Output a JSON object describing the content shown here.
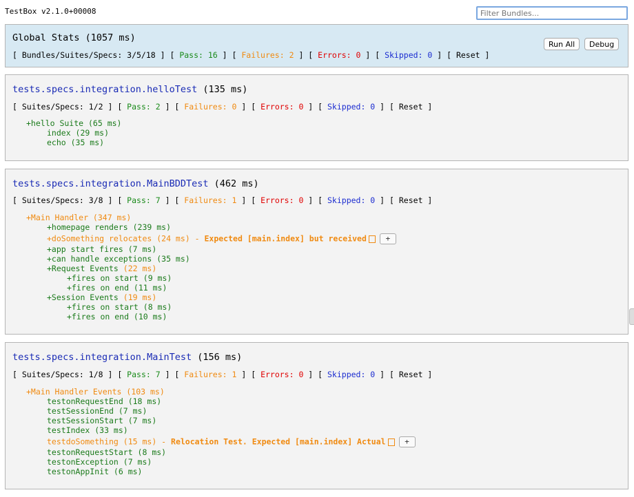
{
  "header": {
    "version": "TestBox v2.1.0+00008",
    "filter_placeholder": "Filter Bundles..."
  },
  "global": {
    "title": "Global Stats (1057 ms)",
    "stats": {
      "prefix": "[ Bundles/Suites/Specs: 3/5/18 ] [ ",
      "pass": "Pass: 16",
      "fail": "Failures: 2",
      "err": "Errors: 0",
      "skip": "Skipped: 0",
      "reset": "Reset"
    },
    "run_all": "Run All",
    "debug": "Debug"
  },
  "bundles": [
    {
      "name": "tests.specs.integration.helloTest",
      "time": " (135 ms)",
      "stats": {
        "prefix": "[ Suites/Specs: 1/2 ] [ ",
        "pass": "Pass: 2",
        "fail": "Failures: 0",
        "err": "Errors: 0",
        "skip": "Skipped: 0",
        "reset": "Reset"
      },
      "lines": [
        "+hello Suite (65 ms)",
        "index (29 ms)",
        "echo (35 ms)"
      ]
    },
    {
      "name": "tests.specs.integration.MainBDDTest",
      "time": " (462 ms)",
      "stats": {
        "prefix": "[ Suites/Specs: 3/8 ] [ ",
        "pass": "Pass: 7",
        "fail": "Failures: 1",
        "err": "Errors: 0",
        "skip": "Skipped: 0",
        "reset": "Reset"
      },
      "lines": [
        "+Main Handler (347 ms)",
        "+homepage renders (239 ms)",
        "+doSomething relocates (24 ms) - ",
        "Expected [main.index] but received",
        "+app start fires (7 ms)",
        "+can handle exceptions (35 ms)",
        "+Request Events",
        " (22 ms)",
        "+fires on start (9 ms)",
        "+fires on end (11 ms)",
        "+Session Events",
        " (19 ms)",
        "+fires on start (8 ms)",
        "+fires on end (10 ms)"
      ],
      "plus": "+"
    },
    {
      "name": "tests.specs.integration.MainTest",
      "time": " (156 ms)",
      "stats": {
        "prefix": "[ Suites/Specs: 1/8 ] [ ",
        "pass": "Pass: 7",
        "fail": "Failures: 1",
        "err": "Errors: 0",
        "skip": "Skipped: 0",
        "reset": "Reset"
      },
      "lines": [
        "+Main Handler Events (103 ms)",
        "testonRequestEnd (18 ms)",
        "testSessionEnd (7 ms)",
        "testSessionStart (7 ms)",
        "testIndex (33 ms)",
        "testdoSomething (15 ms) - ",
        "Relocation Test. Expected [main.index] Actual",
        "testonRequestStart (8 ms)",
        "testonException (7 ms)",
        "testonAppInit (6 ms)"
      ],
      "plus": "+"
    }
  ],
  "sep": {
    "a": " ] [ ",
    "end": " ]"
  }
}
